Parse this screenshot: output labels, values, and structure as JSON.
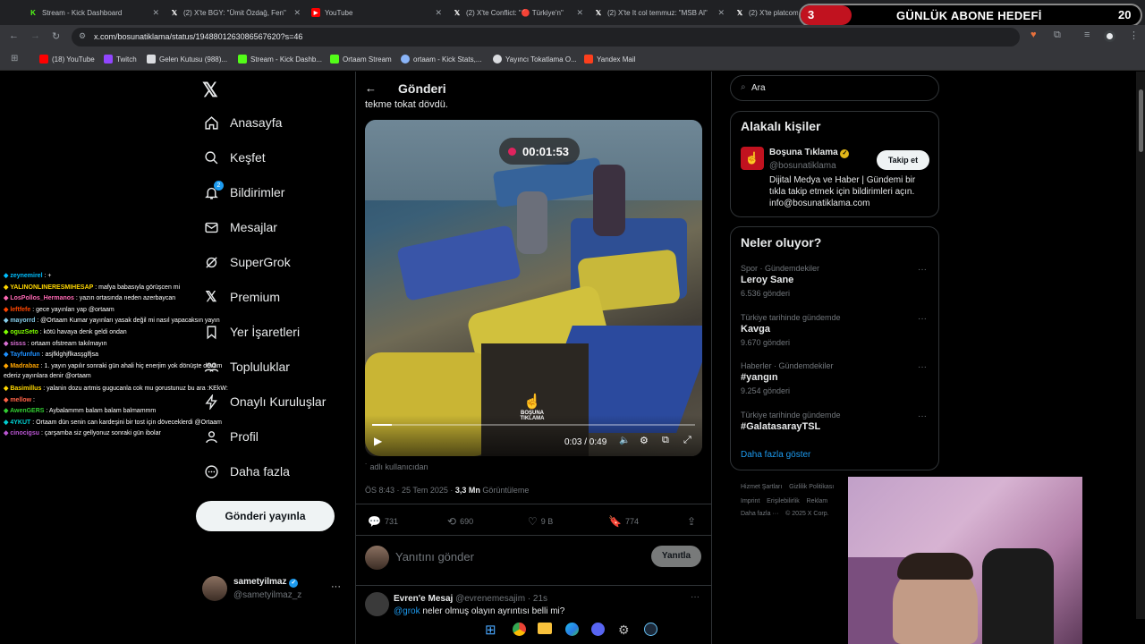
{
  "browser": {
    "tabs": [
      {
        "title": "Stream - Kick Dashboard",
        "icon": "kick-icon",
        "color": "#53fc18"
      },
      {
        "title": "(2) X'te BGY: \"Ümit Özdağ, Fen\"",
        "icon": "x-icon",
        "color": "#ffffff"
      },
      {
        "title": "YouTube",
        "icon": "youtube-icon",
        "color": "#ff0000"
      },
      {
        "title": "(2) X'te Conflict: \"🔴 Türkiye'n\"",
        "icon": "x-icon",
        "color": "#ffffff"
      },
      {
        "title": "(2) X'te It col temmuz: \"MSB Al\"",
        "icon": "x-icon",
        "color": "#ffffff"
      },
      {
        "title": "(2) X'te platcom",
        "icon": "x-icon",
        "color": "#ffffff"
      }
    ],
    "url": "x.com/bosunatiklama/status/1948801263086567620?s=46",
    "bookmarks": [
      {
        "label": "(18) YouTube",
        "color": "#ff0000"
      },
      {
        "label": "Twitch",
        "color": "#9146ff"
      },
      {
        "label": "Gelen Kutusu (988)...",
        "color": "#dadce0"
      },
      {
        "label": "Stream - Kick Dashb...",
        "color": "#53fc18"
      },
      {
        "label": "Ortaam Stream",
        "color": "#53fc18"
      },
      {
        "label": "ortaam - Kick Stats,...",
        "color": "#8ab4f8"
      },
      {
        "label": "Yayıncı Tokatlama O...",
        "color": "#dadce0"
      },
      {
        "label": "Yandex Mail",
        "color": "#fc3f1d"
      }
    ]
  },
  "overlay": {
    "goal_current": "3",
    "goal_title": "GÜNLÜK ABONE HEDEFİ",
    "goal_target": "20",
    "goal_progress": 0.15
  },
  "sidebar": {
    "items": [
      {
        "label": "Anasayfa",
        "icon": "home-icon"
      },
      {
        "label": "Keşfet",
        "icon": "search-icon"
      },
      {
        "label": "Bildirimler",
        "icon": "bell-icon",
        "badge": "2"
      },
      {
        "label": "Mesajlar",
        "icon": "mail-icon"
      },
      {
        "label": "SuperGrok",
        "icon": "grok-icon"
      },
      {
        "label": "Premium",
        "icon": "x-icon"
      },
      {
        "label": "Yer İşaretleri",
        "icon": "bookmark-icon"
      },
      {
        "label": "Topluluklar",
        "icon": "communities-icon"
      },
      {
        "label": "Onaylı Kuruluşlar",
        "icon": "lightning-icon"
      },
      {
        "label": "Profil",
        "icon": "profile-icon"
      },
      {
        "label": "Daha fazla",
        "icon": "more-circle-icon"
      }
    ],
    "post_button": "Gönderi yayınla",
    "user_name": "sametyilmaz",
    "user_handle": "@sametyilmaz_z"
  },
  "post": {
    "header": "Gönderi",
    "text_cut": "tekme tokat dövdü.",
    "video_timer": "00:01:53",
    "watermark": "BOŞUNA TIKLAMA",
    "video_time": "0:03 / 0:49",
    "video_progress": 0.06,
    "caption": "adlı kullanıcıdan",
    "time": "ÖS 8:43 · 25 Tem 2025 · ",
    "views": "3,3 Mn",
    "views_label": " Görüntüleme",
    "replies": "731",
    "reposts": "690",
    "likes": "9 B",
    "bookmarks": "774",
    "reply_placeholder": "Yanıtını gönder",
    "reply_button": "Yanıtla",
    "comment_name": "Evren'e Mesaj",
    "comment_handle": "@evrenemesajim · 21s",
    "comment_mention": "@grok",
    "comment_text": " neler olmuş olayın ayrıntısı belli mi?"
  },
  "right": {
    "search_placeholder": "Ara",
    "related_title": "Alakalı kişiler",
    "related_name": "Boşuna Tıklama",
    "related_handle": "@bosunatiklama",
    "follow_button": "Takip et",
    "related_bio": "Dijital Medya ve Haber | Gündemi bir tıkla takip etmek için bildirimleri açın. info@bosunatiklama.com",
    "trends_title": "Neler oluyor?",
    "trends": [
      {
        "meta": "Spor · Gündemdekiler",
        "name": "Leroy Sane",
        "count": "6.536 gönderi"
      },
      {
        "meta": "Türkiye tarihinde gündemde",
        "name": "Kavga",
        "count": "9.670 gönderi"
      },
      {
        "meta": "Haberler · Gündemdekiler",
        "name": "#yangın",
        "count": "9.254 gönderi"
      },
      {
        "meta": "Türkiye tarihinde gündemde",
        "name": "#GalatasarayTSL",
        "count": ""
      }
    ],
    "show_more": "Daha fazla göster",
    "footer_line1": "Hizmet Şartları    Gizlilik Politikası",
    "footer_line2": "Imprint    Erişilebilirlik    Reklam",
    "footer_line3": "Daha fazla ···    © 2025 X Corp."
  },
  "chat": [
    {
      "user": "zeynemirel",
      "msg": " : +",
      "color": "#00bfff"
    },
    {
      "user": "YALINONLINERESMIHESAP",
      "msg": " : mafya babasıyla görüşcen mi",
      "color": "#ffd700"
    },
    {
      "user": "LosPollos_Hermanos",
      "msg": " : yazın ortasında neden azerbaycan",
      "color": "#ff69b4"
    },
    {
      "user": "leftfefe",
      "msg": " : gece yayınları yap @ortaam",
      "color": "#ff4500"
    },
    {
      "user": "mayorrd",
      "msg": " : @Ortaam Kumar yayınları yasak değil mi nasıl yapacaksın yayın",
      "color": "#87ceeb"
    },
    {
      "user": "oguzSeto",
      "msg": " : kötü havaya denk geldi ondan",
      "color": "#7fff00"
    },
    {
      "user": "sisss",
      "msg": " : ortaam ofstream takılmayın",
      "color": "#da70d6"
    },
    {
      "user": "Tayfunfun",
      "msg": " : asjfklghjflkasşglfjsa",
      "color": "#1e90ff"
    },
    {
      "user": "Madrabaz",
      "msg": " : 1. yayın yapılır sonraki gün ahali hiç enerjim yok dönüşte devam",
      "color": "#ffa500"
    },
    {
      "user": "",
      "msg": "ederiz yayınlara denir @ortaam",
      "color": "#ffffff"
    },
    {
      "user": "Basimillus",
      "msg": " : yalanin dozu artmis gugucanla cok mu gorustunuz bu ara :KEkW:",
      "color": "#ffd700"
    },
    {
      "user": "mellow",
      "msg": " : ",
      "color": "#ff6347"
    },
    {
      "user": "AwenGERS",
      "msg": " : Aybalammm balam balam balmammm",
      "color": "#32cd32"
    },
    {
      "user": "4YKUT",
      "msg": " : Ortaam dün senin can kardeşini bir tost için döveceklerdi @Ortaam",
      "color": "#00ced1"
    },
    {
      "user": "cinocigsu",
      "msg": " : çarşamba siz gellyonuz sonraki gün ibolar",
      "color": "#ba55d3"
    }
  ]
}
